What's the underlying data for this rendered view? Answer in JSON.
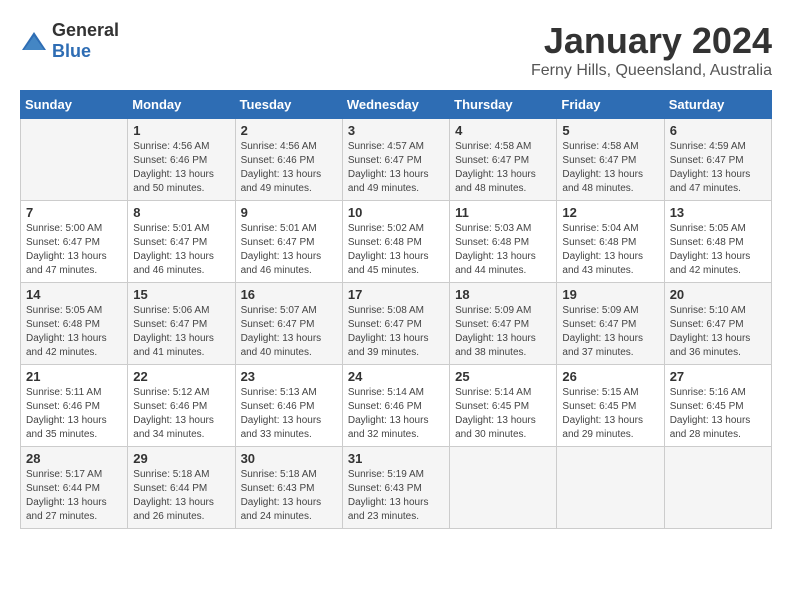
{
  "logo": {
    "general": "General",
    "blue": "Blue"
  },
  "title": "January 2024",
  "subtitle": "Ferny Hills, Queensland, Australia",
  "days_of_week": [
    "Sunday",
    "Monday",
    "Tuesday",
    "Wednesday",
    "Thursday",
    "Friday",
    "Saturday"
  ],
  "weeks": [
    [
      {
        "day": "",
        "info": ""
      },
      {
        "day": "1",
        "info": "Sunrise: 4:56 AM\nSunset: 6:46 PM\nDaylight: 13 hours\nand 50 minutes."
      },
      {
        "day": "2",
        "info": "Sunrise: 4:56 AM\nSunset: 6:46 PM\nDaylight: 13 hours\nand 49 minutes."
      },
      {
        "day": "3",
        "info": "Sunrise: 4:57 AM\nSunset: 6:47 PM\nDaylight: 13 hours\nand 49 minutes."
      },
      {
        "day": "4",
        "info": "Sunrise: 4:58 AM\nSunset: 6:47 PM\nDaylight: 13 hours\nand 48 minutes."
      },
      {
        "day": "5",
        "info": "Sunrise: 4:58 AM\nSunset: 6:47 PM\nDaylight: 13 hours\nand 48 minutes."
      },
      {
        "day": "6",
        "info": "Sunrise: 4:59 AM\nSunset: 6:47 PM\nDaylight: 13 hours\nand 47 minutes."
      }
    ],
    [
      {
        "day": "7",
        "info": "Sunrise: 5:00 AM\nSunset: 6:47 PM\nDaylight: 13 hours\nand 47 minutes."
      },
      {
        "day": "8",
        "info": "Sunrise: 5:01 AM\nSunset: 6:47 PM\nDaylight: 13 hours\nand 46 minutes."
      },
      {
        "day": "9",
        "info": "Sunrise: 5:01 AM\nSunset: 6:47 PM\nDaylight: 13 hours\nand 46 minutes."
      },
      {
        "day": "10",
        "info": "Sunrise: 5:02 AM\nSunset: 6:48 PM\nDaylight: 13 hours\nand 45 minutes."
      },
      {
        "day": "11",
        "info": "Sunrise: 5:03 AM\nSunset: 6:48 PM\nDaylight: 13 hours\nand 44 minutes."
      },
      {
        "day": "12",
        "info": "Sunrise: 5:04 AM\nSunset: 6:48 PM\nDaylight: 13 hours\nand 43 minutes."
      },
      {
        "day": "13",
        "info": "Sunrise: 5:05 AM\nSunset: 6:48 PM\nDaylight: 13 hours\nand 42 minutes."
      }
    ],
    [
      {
        "day": "14",
        "info": "Sunrise: 5:05 AM\nSunset: 6:48 PM\nDaylight: 13 hours\nand 42 minutes."
      },
      {
        "day": "15",
        "info": "Sunrise: 5:06 AM\nSunset: 6:47 PM\nDaylight: 13 hours\nand 41 minutes."
      },
      {
        "day": "16",
        "info": "Sunrise: 5:07 AM\nSunset: 6:47 PM\nDaylight: 13 hours\nand 40 minutes."
      },
      {
        "day": "17",
        "info": "Sunrise: 5:08 AM\nSunset: 6:47 PM\nDaylight: 13 hours\nand 39 minutes."
      },
      {
        "day": "18",
        "info": "Sunrise: 5:09 AM\nSunset: 6:47 PM\nDaylight: 13 hours\nand 38 minutes."
      },
      {
        "day": "19",
        "info": "Sunrise: 5:09 AM\nSunset: 6:47 PM\nDaylight: 13 hours\nand 37 minutes."
      },
      {
        "day": "20",
        "info": "Sunrise: 5:10 AM\nSunset: 6:47 PM\nDaylight: 13 hours\nand 36 minutes."
      }
    ],
    [
      {
        "day": "21",
        "info": "Sunrise: 5:11 AM\nSunset: 6:46 PM\nDaylight: 13 hours\nand 35 minutes."
      },
      {
        "day": "22",
        "info": "Sunrise: 5:12 AM\nSunset: 6:46 PM\nDaylight: 13 hours\nand 34 minutes."
      },
      {
        "day": "23",
        "info": "Sunrise: 5:13 AM\nSunset: 6:46 PM\nDaylight: 13 hours\nand 33 minutes."
      },
      {
        "day": "24",
        "info": "Sunrise: 5:14 AM\nSunset: 6:46 PM\nDaylight: 13 hours\nand 32 minutes."
      },
      {
        "day": "25",
        "info": "Sunrise: 5:14 AM\nSunset: 6:45 PM\nDaylight: 13 hours\nand 30 minutes."
      },
      {
        "day": "26",
        "info": "Sunrise: 5:15 AM\nSunset: 6:45 PM\nDaylight: 13 hours\nand 29 minutes."
      },
      {
        "day": "27",
        "info": "Sunrise: 5:16 AM\nSunset: 6:45 PM\nDaylight: 13 hours\nand 28 minutes."
      }
    ],
    [
      {
        "day": "28",
        "info": "Sunrise: 5:17 AM\nSunset: 6:44 PM\nDaylight: 13 hours\nand 27 minutes."
      },
      {
        "day": "29",
        "info": "Sunrise: 5:18 AM\nSunset: 6:44 PM\nDaylight: 13 hours\nand 26 minutes."
      },
      {
        "day": "30",
        "info": "Sunrise: 5:18 AM\nSunset: 6:43 PM\nDaylight: 13 hours\nand 24 minutes."
      },
      {
        "day": "31",
        "info": "Sunrise: 5:19 AM\nSunset: 6:43 PM\nDaylight: 13 hours\nand 23 minutes."
      },
      {
        "day": "",
        "info": ""
      },
      {
        "day": "",
        "info": ""
      },
      {
        "day": "",
        "info": ""
      }
    ]
  ]
}
